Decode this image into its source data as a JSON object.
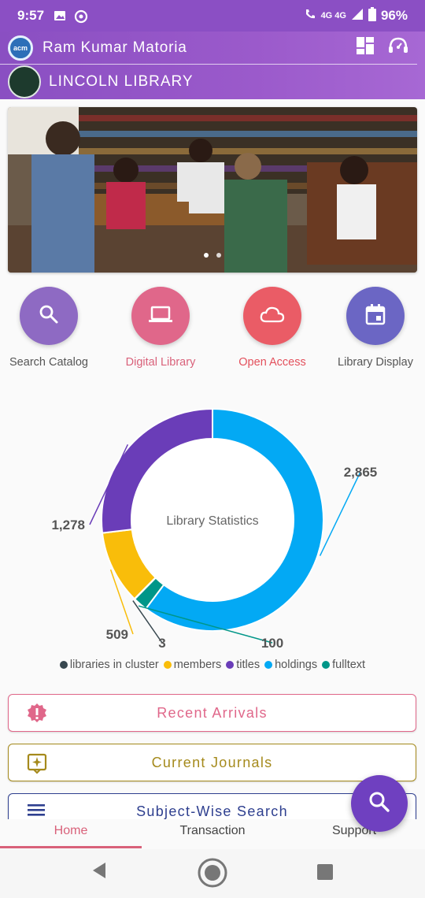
{
  "status_bar": {
    "time": "9:57",
    "network": "4G 4G",
    "battery": "96%"
  },
  "header": {
    "user_name": "Ram Kumar Matoria",
    "library_name": "LINCOLN LIBRARY",
    "acm_logo_text": "acm"
  },
  "quick_actions": [
    {
      "label": "Search Catalog",
      "icon": "search-icon",
      "color": "#8e6ac3",
      "label_color": "#555555"
    },
    {
      "label": "Digital Library",
      "icon": "laptop-icon",
      "color": "#e0678a",
      "label_color": "#d9617a"
    },
    {
      "label": "Open Access",
      "icon": "cloud-icon",
      "color": "#ea5c66",
      "label_color": "#e3505c"
    },
    {
      "label": "Library Display",
      "icon": "calendar-icon",
      "color": "#6b66c4",
      "label_color": "#555555"
    }
  ],
  "chart_data": {
    "type": "pie",
    "title": "Library Statistics",
    "series": [
      {
        "name": "libraries in cluster",
        "value": 3,
        "color": "#37474f"
      },
      {
        "name": "members",
        "value": 509,
        "color": "#f9bd0a"
      },
      {
        "name": "titles",
        "value": 1278,
        "color": "#6a3db8"
      },
      {
        "name": "holdings",
        "value": 2865,
        "color": "#03a9f4"
      },
      {
        "name": "fulltext",
        "value": 100,
        "color": "#009688"
      }
    ],
    "value_labels": [
      "2,865",
      "1,278",
      "509",
      "3",
      "100"
    ]
  },
  "menu": [
    {
      "label": "Recent Arrivals",
      "color": "#e0678a",
      "icon": "alert-badge-icon"
    },
    {
      "label": "Current Journals",
      "color": "#a58a1c",
      "icon": "journal-star-icon"
    },
    {
      "label": "Subject-Wise Search",
      "color": "#2e3f8f",
      "icon": "menu-lines-icon"
    }
  ],
  "bottom_nav": {
    "home": "Home",
    "transaction": "Transaction",
    "support": "Support"
  }
}
